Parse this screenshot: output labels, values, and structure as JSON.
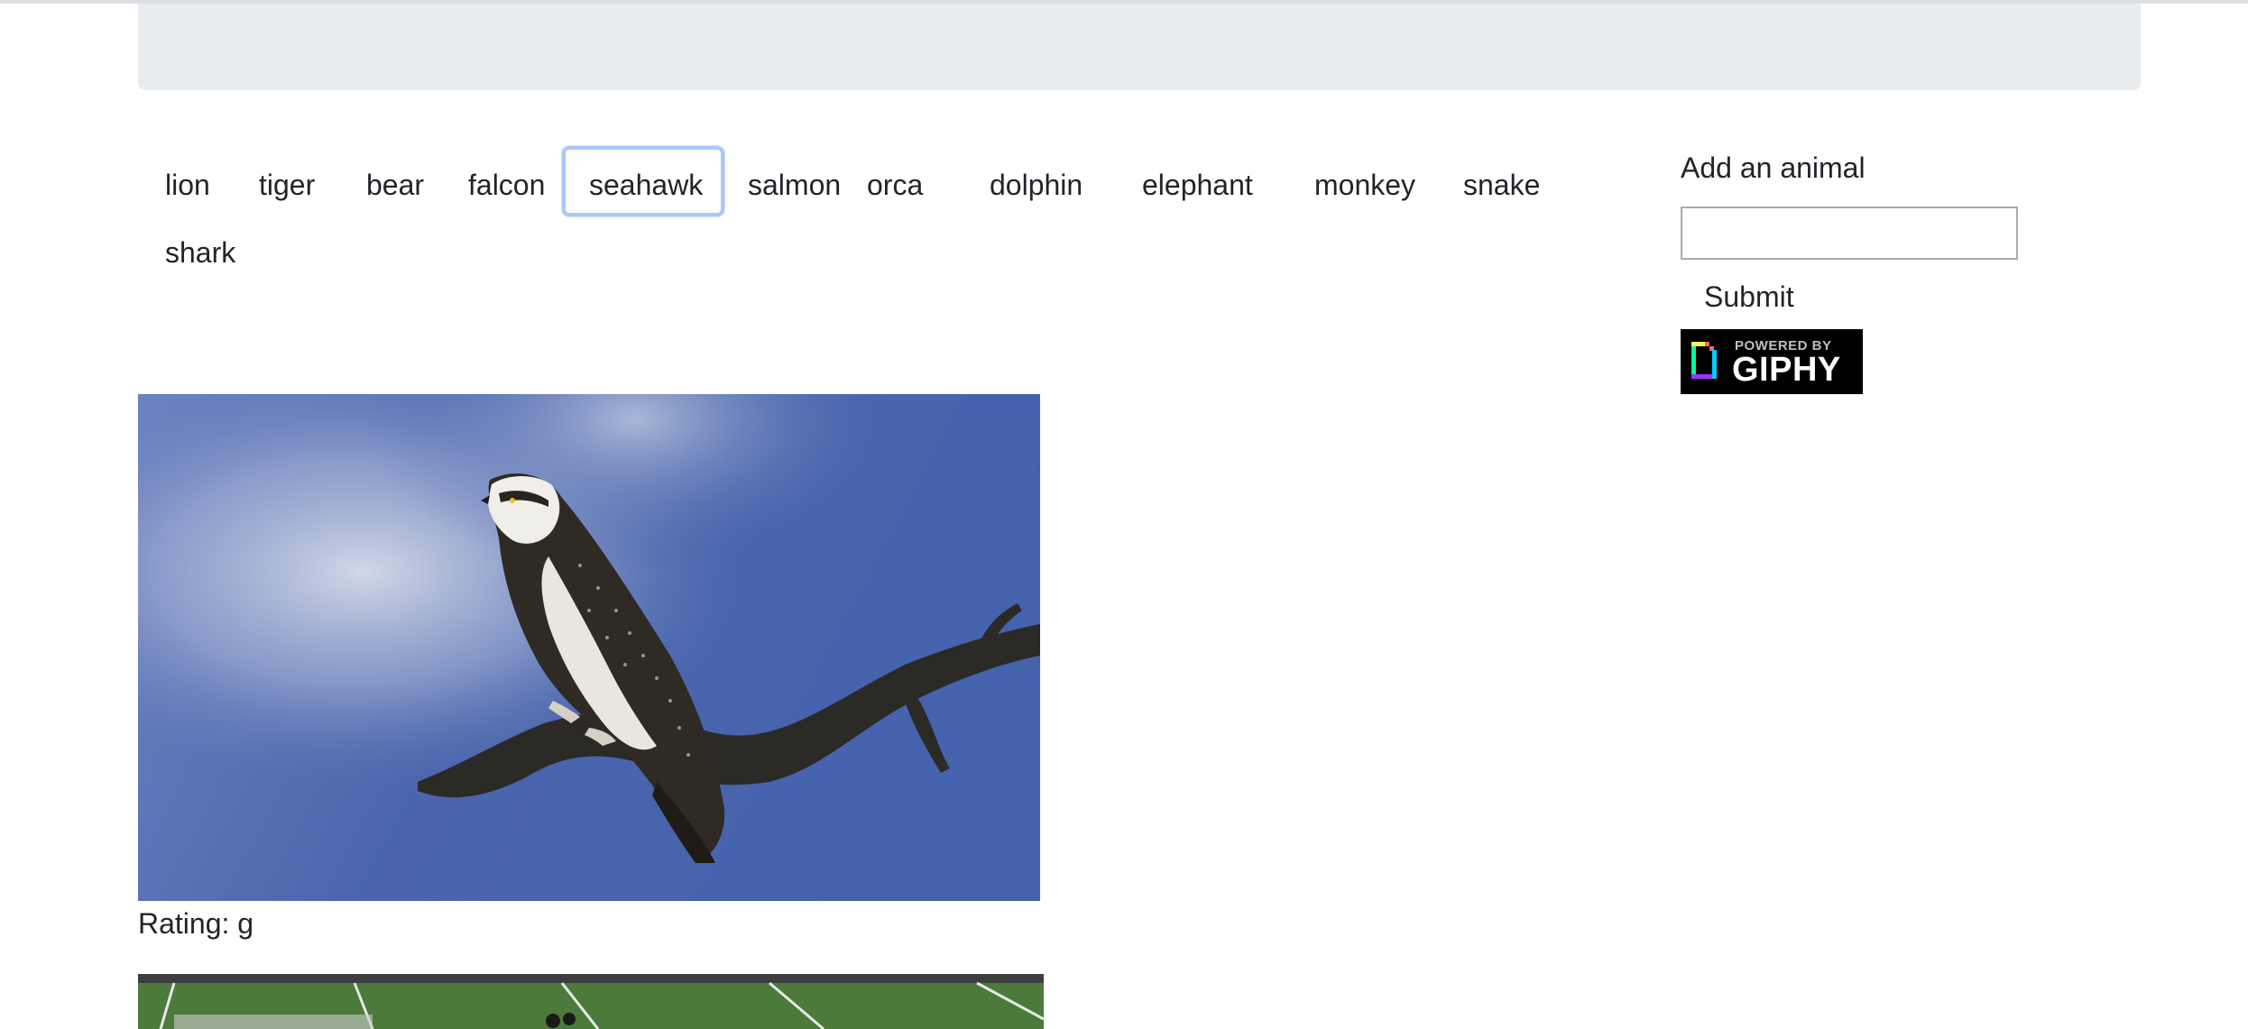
{
  "animals": [
    "lion",
    "tiger",
    "bear",
    "falcon",
    "seahawk",
    "salmon",
    "orca",
    "dolphin",
    "elephant",
    "monkey",
    "snake",
    "shark"
  ],
  "focused_animal": "seahawk",
  "sidebar": {
    "label": "Add an animal",
    "input_value": "",
    "submit_label": "Submit"
  },
  "giphy_badge": {
    "small_text": "POWERED BY",
    "big_text": "GIPHY"
  },
  "results": [
    {
      "rating_label": "Rating: g",
      "image_subject": "osprey on branch"
    },
    {
      "image_subject": "football field"
    }
  ],
  "colors": {
    "jumbotron": "#e9ecef",
    "focus_ring": "#a9c9f5",
    "sky": "#4a65ad"
  }
}
